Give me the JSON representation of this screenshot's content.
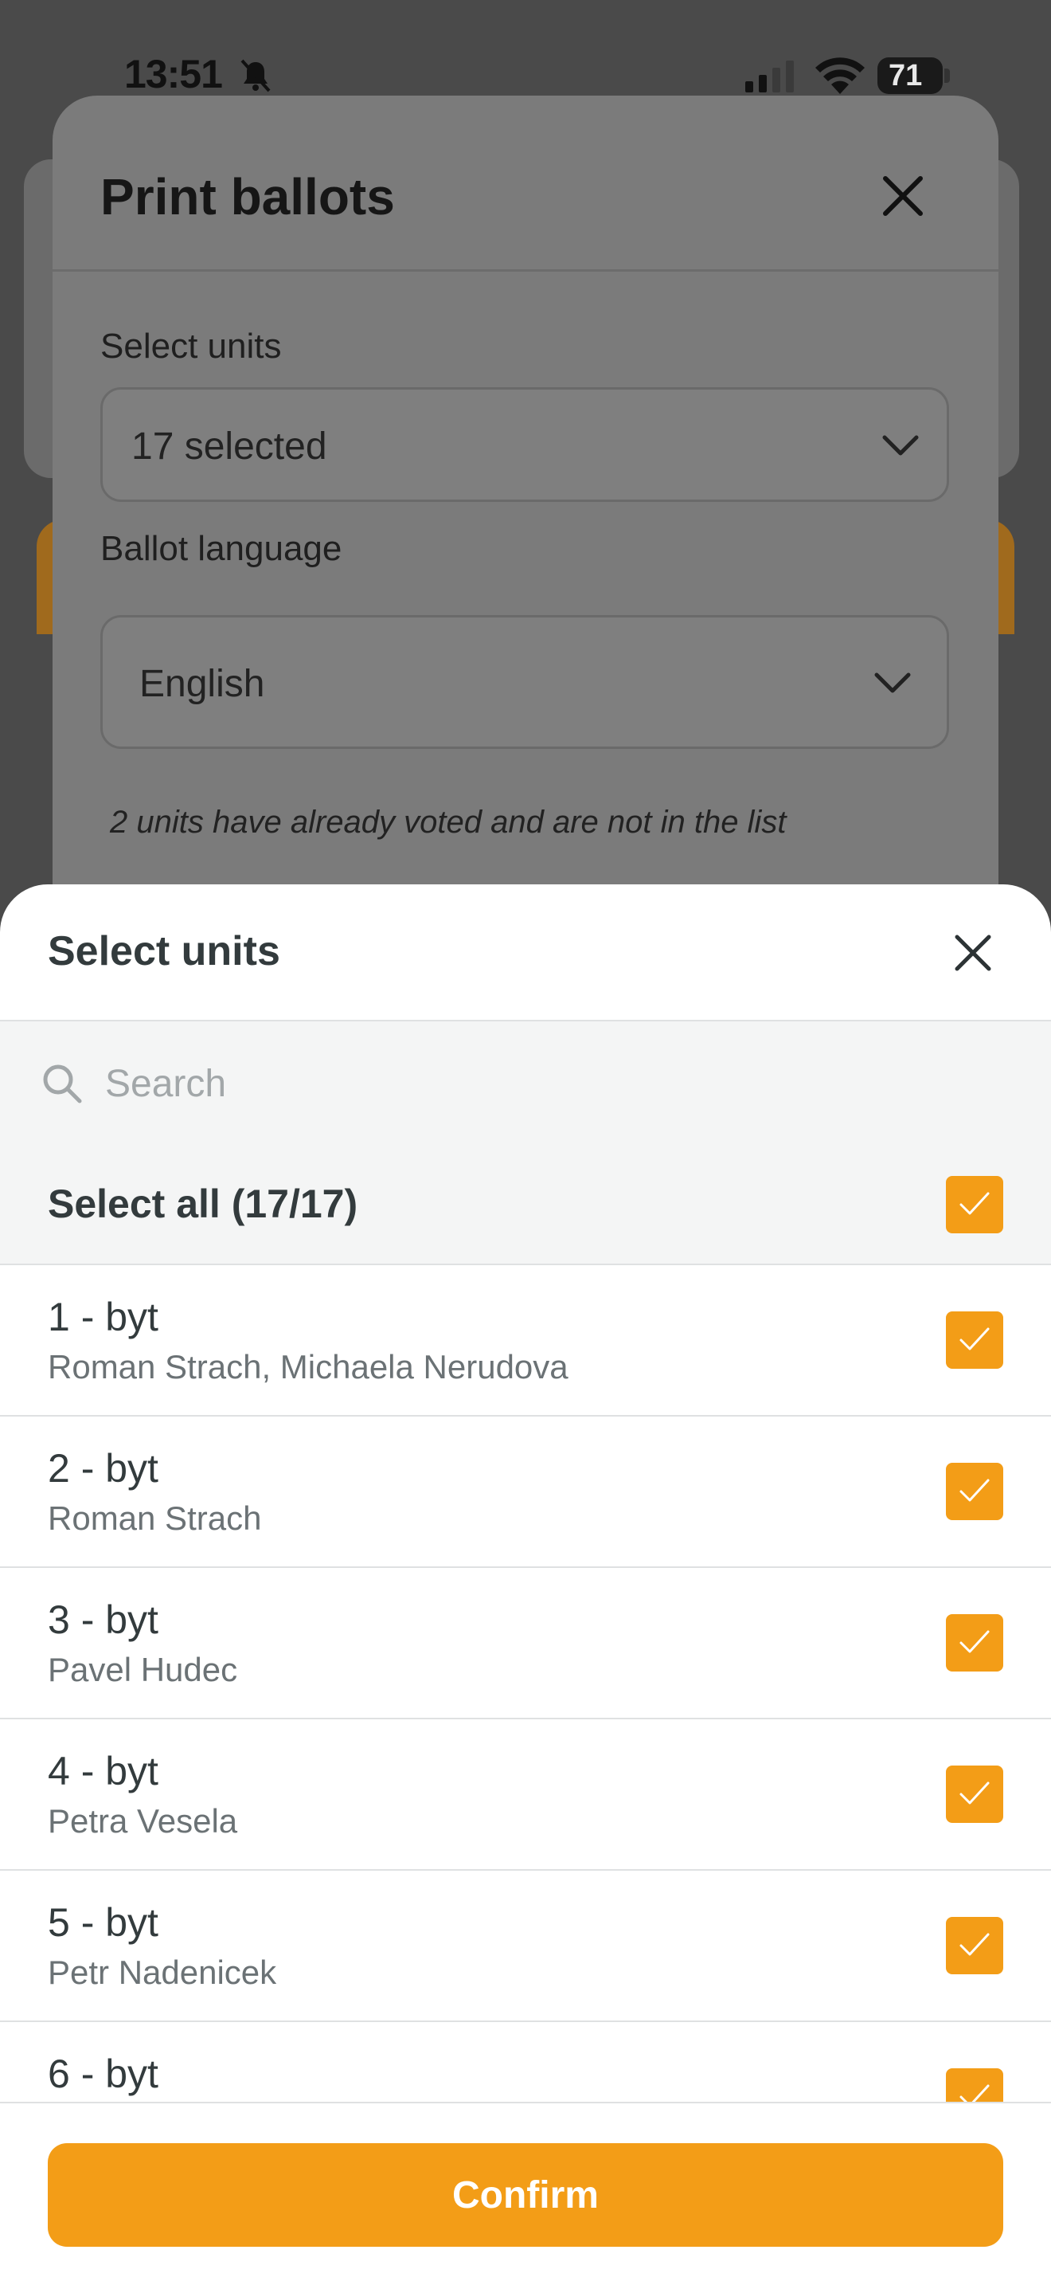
{
  "status_bar": {
    "time": "13:51",
    "battery_level": "71"
  },
  "print_dialog": {
    "title": "Print ballots",
    "units_label": "Select units",
    "units_value": "17 selected",
    "language_label": "Ballot language",
    "language_value": "English",
    "note": "2 units have already voted and are not in the list"
  },
  "sheet": {
    "title": "Select units",
    "search_placeholder": "Search",
    "select_all_label": "Select all (17/17)",
    "select_all_checked": true,
    "units": [
      {
        "title": "1 - byt",
        "owner": "Roman Strach, Michaela Nerudova",
        "checked": true
      },
      {
        "title": "2 - byt",
        "owner": "Roman Strach",
        "checked": true
      },
      {
        "title": "3 - byt",
        "owner": "Pavel Hudec",
        "checked": true
      },
      {
        "title": "4 - byt",
        "owner": "Petra Vesela",
        "checked": true
      },
      {
        "title": "5 - byt",
        "owner": "Petr Nadenicek",
        "checked": true
      },
      {
        "title": "6 - byt",
        "owner": "",
        "checked": true
      }
    ],
    "confirm_label": "Confirm"
  },
  "colors": {
    "accent": "#f39d17",
    "text_primary": "#333b3d",
    "text_secondary": "#6b7275"
  }
}
